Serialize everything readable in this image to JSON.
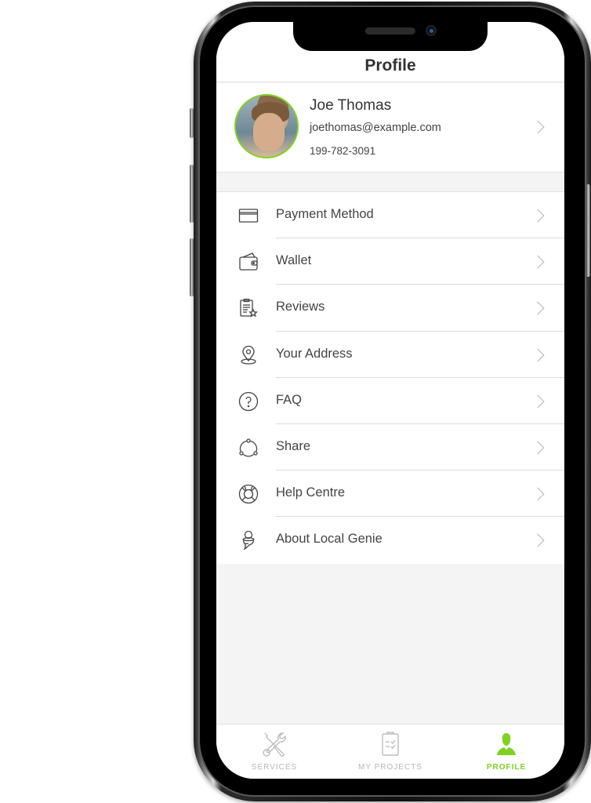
{
  "header": {
    "title": "Profile"
  },
  "profile": {
    "name": "Joe Thomas",
    "email": "joethomas@example.com",
    "phone": "199-782-3091",
    "avatar_icon": "user-photo"
  },
  "menu": {
    "items": [
      {
        "label": "Payment Method",
        "icon": "credit-card-icon"
      },
      {
        "label": "Wallet",
        "icon": "wallet-icon"
      },
      {
        "label": "Reviews",
        "icon": "review-clipboard-star-icon"
      },
      {
        "label": "Your Address",
        "icon": "location-pin-icon"
      },
      {
        "label": "FAQ",
        "icon": "question-circle-icon"
      },
      {
        "label": "Share",
        "icon": "share-icon"
      },
      {
        "label": "Help Centre",
        "icon": "lifebuoy-icon"
      },
      {
        "label": "About Local Genie",
        "icon": "genie-icon"
      }
    ]
  },
  "tabbar": {
    "tabs": [
      {
        "label": "SERVICES",
        "icon": "tools-icon",
        "active": false
      },
      {
        "label": "MY PROJECTS",
        "icon": "clipboard-check-icon",
        "active": false
      },
      {
        "label": "PROFILE",
        "icon": "user-icon",
        "active": true
      }
    ]
  },
  "colors": {
    "accent": "#7ed321",
    "text": "#444444",
    "inactive_tab": "#b8b8b8",
    "background": "#f4f4f4"
  }
}
